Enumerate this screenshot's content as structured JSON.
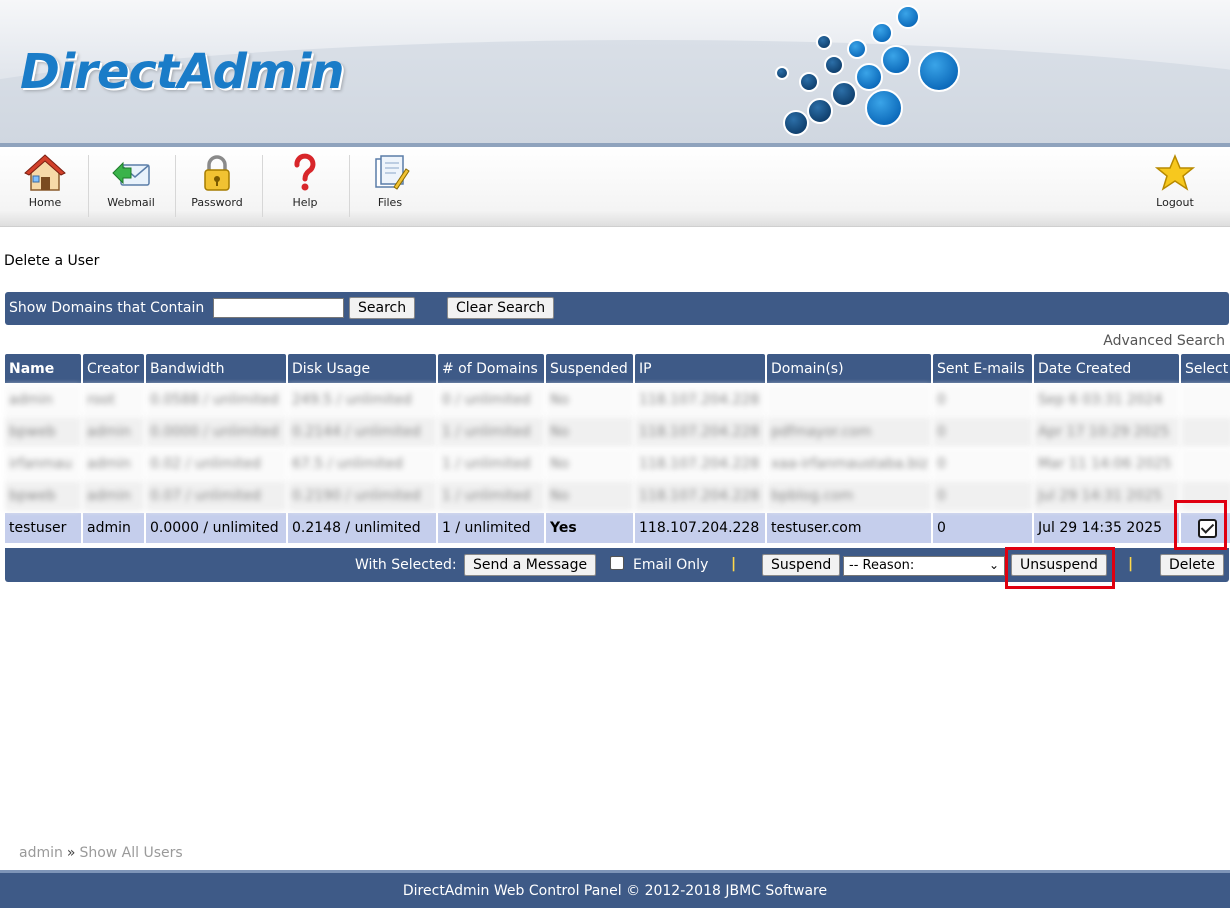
{
  "brand": {
    "logo_text": "DirectAdmin"
  },
  "toolbar": {
    "home": "Home",
    "webmail": "Webmail",
    "password": "Password",
    "help": "Help",
    "files": "Files",
    "logout": "Logout"
  },
  "page": {
    "heading": "Delete a User"
  },
  "search": {
    "label": "Show Domains that Contain",
    "value": "",
    "search_button": "Search",
    "clear_button": "Clear Search",
    "advanced": "Advanced Search"
  },
  "table": {
    "headers": [
      "Name",
      "Creator",
      "Bandwidth",
      "Disk Usage",
      "# of Domains",
      "Suspended",
      "IP",
      "Domain(s)",
      "Sent E-mails",
      "Date Created",
      "Select"
    ],
    "blurred_rows": [
      [
        "admin",
        "root",
        "0.0588 / unlimited",
        "249.5 / unlimited",
        "0 / unlimited",
        "No",
        "118.107.204.228",
        "",
        "0",
        "Sep 6 03:31 2024",
        ""
      ],
      [
        "bpweb",
        "admin",
        "0.0000 / unlimited",
        "0.2144 / unlimited",
        "1 / unlimited",
        "No",
        "118.107.204.228",
        "pdfmayor.com",
        "0",
        "Apr 17 10:29 2025",
        ""
      ],
      [
        "irfanmau",
        "admin",
        "0.02 / unlimited",
        "67.5 / unlimited",
        "1 / unlimited",
        "No",
        "118.107.204.228",
        "xaa-irfanmaustaba.biz",
        "0",
        "Mar 11 14:06 2025",
        ""
      ],
      [
        "bpweb",
        "admin",
        "0.07 / unlimited",
        "0.2190 / unlimited",
        "1 / unlimited",
        "No",
        "118.107.204.228",
        "bpblog.com",
        "0",
        "Jul 29 14:31 2025",
        ""
      ]
    ],
    "selected_row": {
      "name": "testuser",
      "creator": "admin",
      "bandwidth": "0.0000 / unlimited",
      "disk_usage": "0.2148 / unlimited",
      "domains_count": "1 / unlimited",
      "suspended": "Yes",
      "ip": "118.107.204.228",
      "domains": "testuser.com",
      "sent_emails": "0",
      "date_created": "Jul 29 14:35 2025",
      "checked": true
    }
  },
  "actions": {
    "with_selected": "With Selected:",
    "send_message": "Send a Message",
    "email_only": "Email Only",
    "divider": "|",
    "suspend": "Suspend",
    "reason_selected": "-- Reason:",
    "unsuspend": "Unsuspend",
    "delete": "Delete"
  },
  "breadcrumb": {
    "root": "admin",
    "separator": "»",
    "current": "Show All Users"
  },
  "footer": {
    "text": "DirectAdmin Web Control Panel © 2012-2018 JBMC Software"
  },
  "colors": {
    "header_bar": "#3e5a87",
    "selected_row": "#c5ceec",
    "highlight": "#e00010",
    "suspended_yes": "#e00000"
  }
}
